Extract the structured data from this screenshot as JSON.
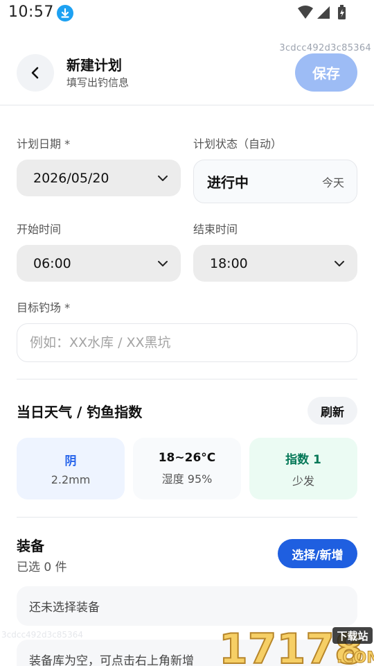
{
  "status_bar": {
    "time": "10:57",
    "download_icon": "download-icon",
    "wifi_icon": "wifi-icon",
    "signal_icon": "signal-icon",
    "battery_icon": "battery-charging-icon"
  },
  "hash": "3cdcc492d3c85364",
  "header": {
    "title": "新建计划",
    "subtitle": "填写出钓信息",
    "save_label": "保存",
    "back_icon": "chevron-left-icon"
  },
  "form": {
    "date_label": "计划日期 *",
    "date_value": "2026/05/20",
    "status_label": "计划状态（自动）",
    "status_value": "进行中",
    "status_tag": "今天",
    "start_label": "开始时间",
    "start_value": "06:00",
    "end_label": "结束时间",
    "end_value": "18:00",
    "spot_label": "目标钓场 *",
    "spot_placeholder": "例如：XX水库 / XX黑坑",
    "spot_value": ""
  },
  "weather": {
    "title": "当日天气 / 钓鱼指数",
    "refresh_label": "刷新",
    "cards": [
      {
        "line1": "阴",
        "line2": "2.2mm",
        "bg": "#eef4ff",
        "color": "#2563eb"
      },
      {
        "line1": "18~26°C",
        "line2": "湿度 95%",
        "bg": "#f8fafc",
        "color": "#111111"
      },
      {
        "line1": "指数 1",
        "line2": "少发",
        "bg": "#ebfbf3",
        "color": "#047857"
      }
    ]
  },
  "gear": {
    "title": "装备",
    "count_text": "已选 0 件",
    "pick_label": "选择/新增",
    "empty_selected": "还未选择装备",
    "empty_library": "装备库为空，可点击右上角新增"
  },
  "watermark": {
    "text": "17178",
    "suffix": ".COM",
    "badge": "下载站"
  },
  "ghost_text": "3cdcc492d3c85364",
  "colors": {
    "primary": "#1f5fe0",
    "save_disabled": "#9dbcf5",
    "select_bg": "#ececec"
  }
}
